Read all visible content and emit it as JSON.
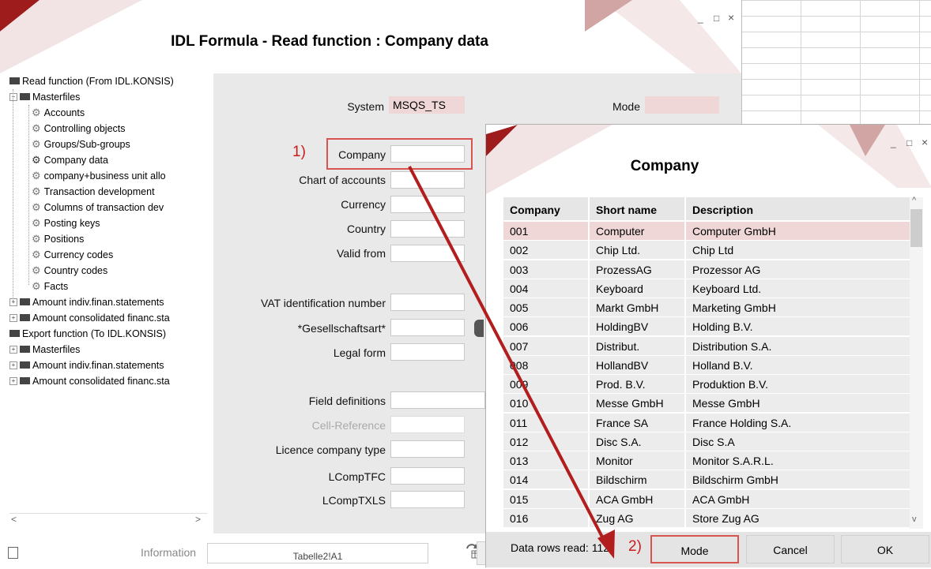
{
  "main_window": {
    "title": "IDL Formula - Read function : Company data",
    "controls": {
      "minimize": "_",
      "maximize": "□",
      "close": "×"
    }
  },
  "tree": [
    {
      "label": "Read function (From IDL.KONSIS)",
      "kind": "folder-root"
    },
    {
      "label": "Masterfiles",
      "kind": "folder",
      "toggle": "−"
    },
    {
      "label": "Accounts",
      "kind": "leaf"
    },
    {
      "label": "Controlling objects",
      "kind": "leaf"
    },
    {
      "label": "Groups/Sub-groups",
      "kind": "leaf"
    },
    {
      "label": "Company data",
      "kind": "leaf-selected"
    },
    {
      "label": "company+business unit allo",
      "kind": "leaf"
    },
    {
      "label": "Transaction development",
      "kind": "leaf"
    },
    {
      "label": "Columns of transaction dev",
      "kind": "leaf"
    },
    {
      "label": "Posting keys",
      "kind": "leaf"
    },
    {
      "label": "Positions",
      "kind": "leaf"
    },
    {
      "label": "Currency codes",
      "kind": "leaf"
    },
    {
      "label": "Country codes",
      "kind": "leaf"
    },
    {
      "label": "Facts",
      "kind": "leaf"
    },
    {
      "label": "Amount indiv.finan.statements",
      "kind": "folder",
      "toggle": "+"
    },
    {
      "label": "Amount consolidated financ.sta",
      "kind": "folder",
      "toggle": "+"
    },
    {
      "label": "Export function (To IDL.KONSIS)",
      "kind": "folder-root"
    },
    {
      "label": "Masterfiles",
      "kind": "folder",
      "toggle": "+"
    },
    {
      "label": "Amount indiv.finan.statements",
      "kind": "folder",
      "toggle": "+"
    },
    {
      "label": "Amount consolidated financ.sta",
      "kind": "folder",
      "toggle": "+"
    }
  ],
  "form": {
    "system_label": "System",
    "system_value": "MSQS_TS",
    "mode_label": "Mode",
    "mode_value": "",
    "step1": "1)",
    "company_label": "Company",
    "chart_of_accounts_label": "Chart of accounts",
    "currency_label": "Currency",
    "country_label": "Country",
    "valid_from_label": "Valid from",
    "vat_label": "VAT identification number",
    "gesellschaftsart_label": "*Gesellschaftsart*",
    "legal_form_label": "Legal form",
    "field_definitions_label": "Field definitions",
    "cell_reference_label": "Cell-Reference",
    "licence_company_type_label": "Licence company type",
    "lcomptfc_label": "LCompTFC",
    "lcomptxls_label": "LCompTXLS"
  },
  "status_bar": {
    "information_label": "Information",
    "information_value": "Tabelle2!A1"
  },
  "dialog": {
    "title": "Company",
    "columns": [
      "Company",
      "Short name",
      "Description"
    ],
    "rows": [
      [
        "001",
        "Computer",
        "Computer GmbH"
      ],
      [
        "002",
        "Chip Ltd.",
        "Chip Ltd"
      ],
      [
        "003",
        "ProzessAG",
        "Prozessor AG"
      ],
      [
        "004",
        "Keyboard",
        "Keyboard Ltd."
      ],
      [
        "005",
        "Markt GmbH",
        "Marketing GmbH"
      ],
      [
        "006",
        "HoldingBV",
        "Holding B.V."
      ],
      [
        "007",
        "Distribut.",
        "Distribution S.A."
      ],
      [
        "008",
        "HollandBV",
        "Holland B.V."
      ],
      [
        "009",
        "Prod. B.V.",
        "Produktion B.V."
      ],
      [
        "010",
        "Messe GmbH",
        "Messe GmbH"
      ],
      [
        "011",
        "France SA",
        "France Holding S.A."
      ],
      [
        "012",
        "Disc S.A.",
        "Disc S.A"
      ],
      [
        "013",
        "Monitor",
        "Monitor S.A.R.L."
      ],
      [
        "014",
        "Bildschirm",
        "Bildschirm GmbH"
      ],
      [
        "015",
        "ACA GmbH",
        "ACA GmbH"
      ],
      [
        "016",
        "Zug AG",
        "Store Zug AG"
      ]
    ],
    "selected_row": 0,
    "data_rows_read": "Data rows read: 112",
    "step2": "2)",
    "mode_button": "Mode",
    "cancel_button": "Cancel",
    "ok_button": "OK",
    "controls": {
      "minimize": "_",
      "maximize": "□",
      "close": "×"
    }
  },
  "colors": {
    "accent_red": "#cc1b1b",
    "selected_row": "#efd7d7",
    "form_background": "#e9e9e9"
  }
}
